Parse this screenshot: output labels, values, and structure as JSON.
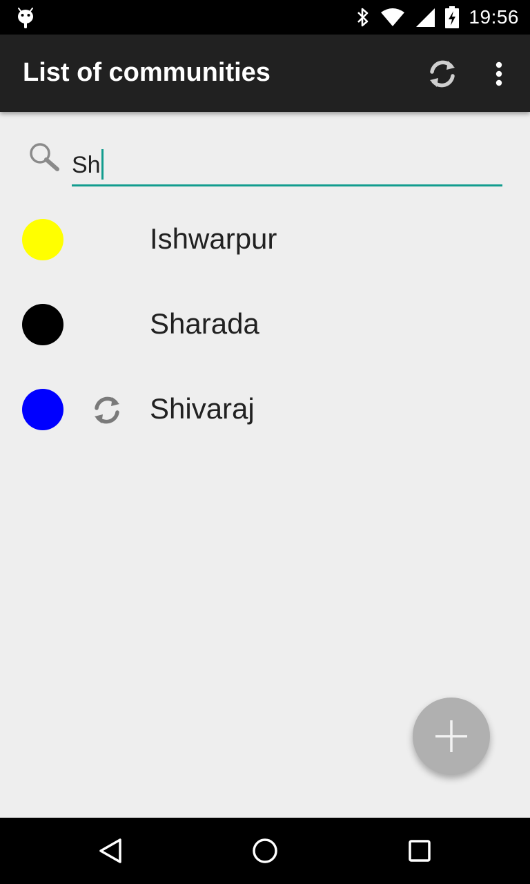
{
  "status_bar": {
    "time": "19:56",
    "icons": [
      "android-debug-icon",
      "bluetooth-icon",
      "wifi-icon",
      "cell-signal-icon",
      "battery-charging-icon"
    ]
  },
  "app_bar": {
    "title": "List of communities",
    "actions": [
      "sync-icon",
      "overflow-menu-icon"
    ]
  },
  "search": {
    "icon": "search-icon",
    "value": "Sh",
    "accent_color": "#129c8e"
  },
  "communities": [
    {
      "name": "Ishwarpur",
      "color": "#ffff00",
      "syncing": false
    },
    {
      "name": "Sharada",
      "color": "#000000",
      "syncing": false
    },
    {
      "name": "Shivaraj",
      "color": "#0000ff",
      "syncing": true
    }
  ],
  "fab": {
    "icon": "plus-icon",
    "color": "#b0b0b0"
  },
  "nav_bar": {
    "buttons": [
      "back-icon",
      "home-icon",
      "recents-icon"
    ]
  }
}
